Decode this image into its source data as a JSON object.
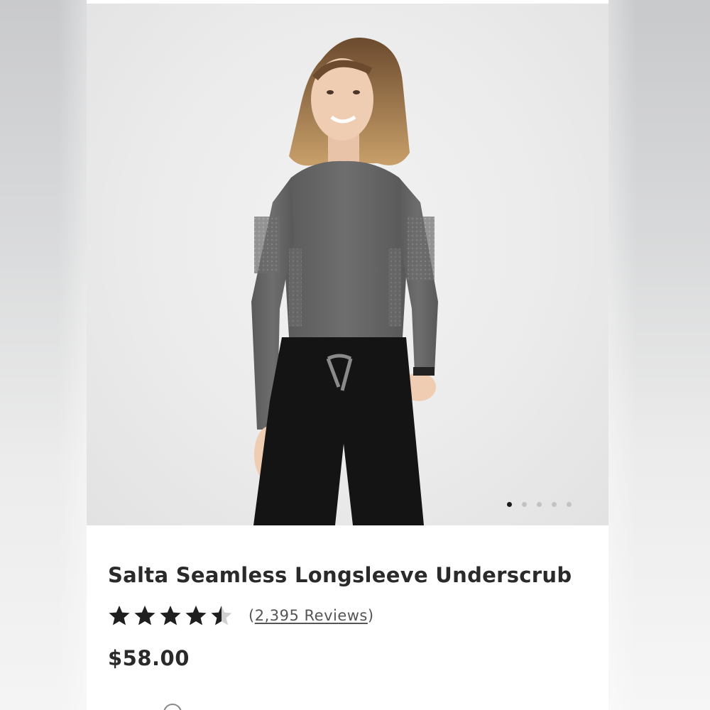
{
  "product": {
    "title": "Salta Seamless Longsleeve Underscrub",
    "rating_value": 4.5,
    "rating_max": 5,
    "reviews_open": "(",
    "reviews_label": "2,395 Reviews",
    "reviews_close": ")",
    "price": "$58.00"
  },
  "gallery": {
    "image_count": 5,
    "active_index": 0
  },
  "colors": {
    "text": "#2a2a2a",
    "star": "#1f1f1f",
    "dot_active": "#1a1a1a",
    "dot_inactive": "#c3c3c3"
  }
}
